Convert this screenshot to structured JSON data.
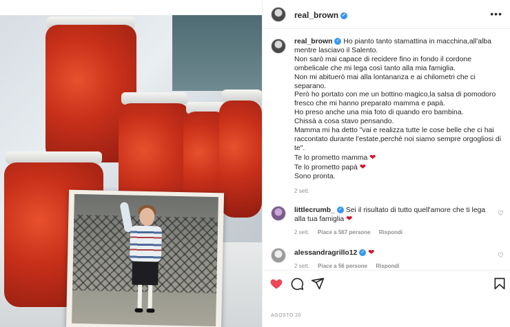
{
  "post": {
    "author": "real_brown",
    "date": "AGOSTO 20"
  },
  "caption": {
    "username": "real_brown",
    "lines": [
      "Ho pianto tanto stamattina in macchina,all'alba mentre lasciavo il Salento.",
      "Non sarò mai capace di recidere fino in fondo il cordone ombelicale che mi lega così tanto alla mia famiglia.",
      "Non mi abituerò mai alla lontananza e ai chilometri che ci separano.",
      "Però ho portato con me un bottino magico,la salsa di pomodoro fresco che mi hanno preparato mamma e papà.",
      "Ho preso anche una mia foto di quando ero bambina.",
      "Chissà a cosa stavo pensando.",
      "Mamma mi ha detto \"vai e realizza tutte le cose belle che ci hai raccontato durante l'estate,perché noi siamo sempre orgogliosi di te\"."
    ],
    "promise_mom": "Te lo prometto mamma",
    "promise_dad": "Te lo prometto papà",
    "ready": "Sono pronta.",
    "time": "2 sett."
  },
  "comments": [
    {
      "username": "littlecrumb_",
      "text": "Sei il risultato di tutto quell'amore che ti lega alla tua famiglia",
      "time": "2 sett.",
      "likes": "Piace a 567 persone",
      "reply": "Rispondi"
    },
    {
      "username": "alessandragrillo12",
      "text": "",
      "time": "2 sett.",
      "likes": "Piace a 56 persone",
      "reply": "Rispondi"
    }
  ],
  "icons": {
    "like": "heart-filled-icon",
    "comment": "comment-icon",
    "share": "share-icon",
    "save": "bookmark-icon",
    "more": "more-icon",
    "verified": "verified-icon"
  },
  "colors": {
    "like_red": "#ed4956",
    "verified_blue": "#3897f0",
    "muted": "#8e8e8e"
  }
}
